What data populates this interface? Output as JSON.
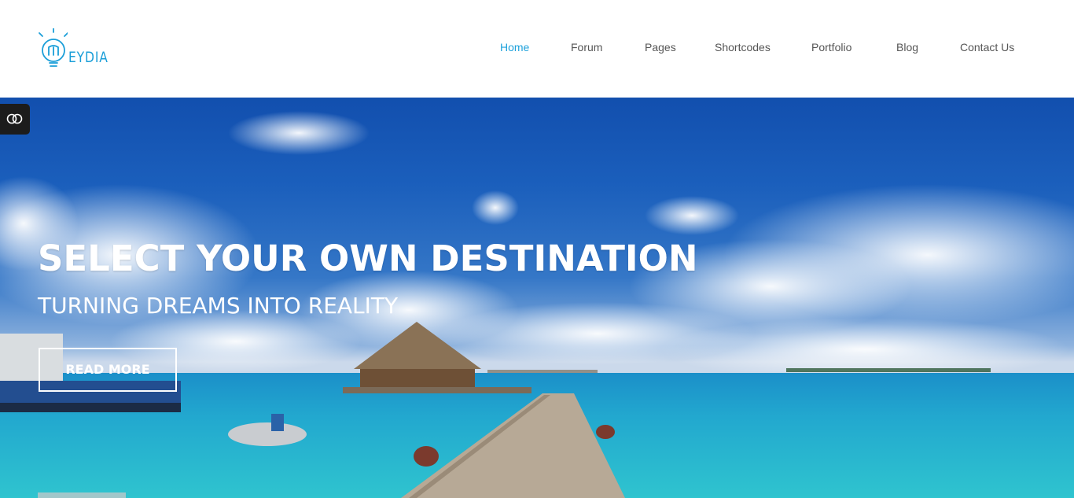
{
  "header": {
    "logo_text": "EYDIA",
    "nav": [
      {
        "label": "Home",
        "active": true
      },
      {
        "label": "Forum",
        "active": false
      },
      {
        "label": "Pages",
        "active": false
      },
      {
        "label": "Shortcodes",
        "active": false
      },
      {
        "label": "Portfolio",
        "active": false
      },
      {
        "label": "Blog",
        "active": false
      },
      {
        "label": "Contact Us",
        "active": false
      }
    ]
  },
  "hero": {
    "title": "SELECT YOUR OWN DESTINATION",
    "subtitle": "TURNING DREAMS INTO REALITY",
    "cta_label": "READ MORE"
  },
  "colors": {
    "accent": "#1ea1db",
    "nav_text": "#555555",
    "toggle_bg": "#1c1c1c"
  },
  "icons": {
    "logo": "lightbulb-icon",
    "toggle": "toggle-icon"
  }
}
